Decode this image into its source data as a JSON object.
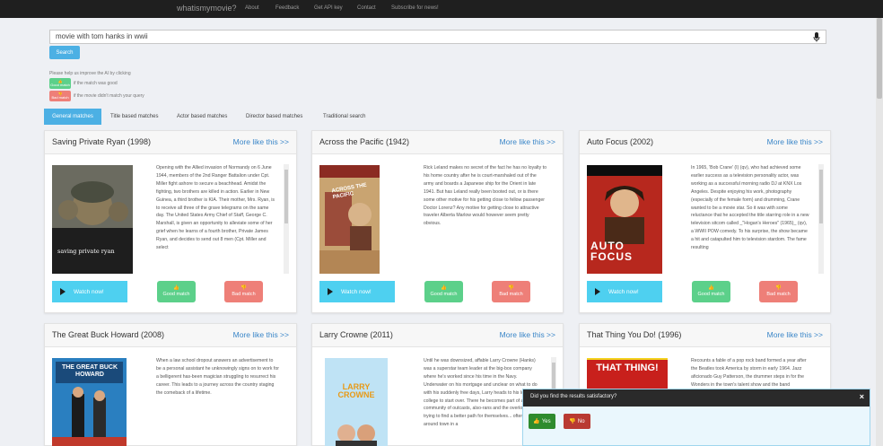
{
  "nav": {
    "brand": "whatismymovie?",
    "links": [
      "About",
      "Feedback",
      "Get API key",
      "Contact",
      "Subscribe for news!"
    ]
  },
  "search": {
    "value": "movie with tom hanks in wwii",
    "button_label": "Search"
  },
  "help": {
    "intro": "Please help us improve the AI by clicking",
    "good_badge_line1": "👍",
    "good_badge_line2": "Good match",
    "good_text": "if the match was good",
    "bad_badge_line1": "👎",
    "bad_badge_line2": "Bad match",
    "bad_text": "if the movie didn't match your query"
  },
  "tabs": [
    "General matches",
    "Title based matches",
    "Actor based matches",
    "Director based matches",
    "Traditional search"
  ],
  "cards": [
    {
      "title": "Saving Private Ryan (1998)",
      "more": "More like this >>",
      "poster_title": "saving private ryan",
      "description": "Opening with the Allied invasion of Normandy on 6 June 1944, members of the 2nd Ranger Battalion under Cpt. Miller fight ashore to secure a beachhead. Amidst the fighting, two brothers are killed in action. Earlier in New Guinea, a third brother is KIA. Their mother, Mrs. Ryan, is to receive all three of the grave telegrams on the same day. The United States Army Chief of Staff, George C. Marshall, is given an opportunity to alleviate some of her grief when he learns of a fourth brother, Private James Ryan, and decides to send out 8 men (Cpt. Miller and select",
      "watch": "Watch now!",
      "good": "Good match",
      "bad": "Bad match"
    },
    {
      "title": "Across the Pacific (1942)",
      "more": "More like this >>",
      "poster_title": "ACROSS THE PACIFIC",
      "description": "Rick Leland makes no secret of the fact he has no loyalty to his home country after he is court-marshaled out of the army and boards a Japanese ship for the Orient in late 1941. But has Leland really been booted out, or is there some other motive for his getting close to fellow passenger Doctor Lorenz? Any motive for getting close to attractive traveler Alberta Marlow would however seem pretty obvious.",
      "watch": "Watch now!",
      "good": "Good match",
      "bad": "Bad match"
    },
    {
      "title": "Auto Focus (2002)",
      "more": "More like this >>",
      "poster_title": "AUTO FOCUS",
      "description": "In 1965, 'Bob Crane' (I) (qv), who had achieved some earlier success as a television personality actor, was working as a successful morning radio DJ at KNX Los Angeles. Despite enjoying his work, photography (especially of the female form) and drumming, Crane wanted to be a movie star. So it was with some reluctance that he accepted the title starring role in a new television sitcom called _\"Hogan's Heroes\" (1965)_ (qv), a WWII POW comedy. To his surprise, the show became a hit and catapulted him to television stardom. The fame resulting",
      "watch": "Watch now!",
      "good": "Good match",
      "bad": "Bad match"
    },
    {
      "title": "The Great Buck Howard (2008)",
      "more": "More like this >>",
      "poster_title": "THE GREAT BUCK HOWARD",
      "description": "When a law school dropout answers an advertisement to be a personal assistant he unknowingly signs on to work for a belligerent has-been magician struggling to resurrect his career. This leads to a journey across the country staging the comeback of a lifetime."
    },
    {
      "title": "Larry Crowne (2011)",
      "more": "More like this >>",
      "poster_title": "LARRY CROWNE",
      "description": "Until he was downsized, affable Larry Crowne (Hanks) was a superstar team leader at the big-box company where he's worked since his time in the Navy. Underwater on his mortgage and unclear on what to do with his suddenly free days, Larry heads to his local college to start over. There he becomes part of a colorful community of outcasts, also-rans and the overlooked all trying to find a better path for themselves... often moving around town in a"
    },
    {
      "title": "That Thing You Do! (1996)",
      "more": "More like this >>",
      "poster_title": "THAT THING!",
      "description": "Recounts a fable of a pop rock band formed a year after the Beatles took America by storm in early 1964. Jazz aficionado Guy Patterson, the drummer steps in for the Wonders in the town's talent show and the band becomes a one-hit wonder. Soon the band takes off, signs the Wonders into a brief whirlwind of success"
    }
  ],
  "popup": {
    "question": "Did you find the results satisfactory?",
    "close": "×",
    "yes": "Yes",
    "no": "No"
  },
  "colors": {
    "accent": "#4cb0e4",
    "watch": "#4ed0f0",
    "good": "#5cd08a",
    "bad": "#ee7f78",
    "link": "#3a86c8"
  }
}
